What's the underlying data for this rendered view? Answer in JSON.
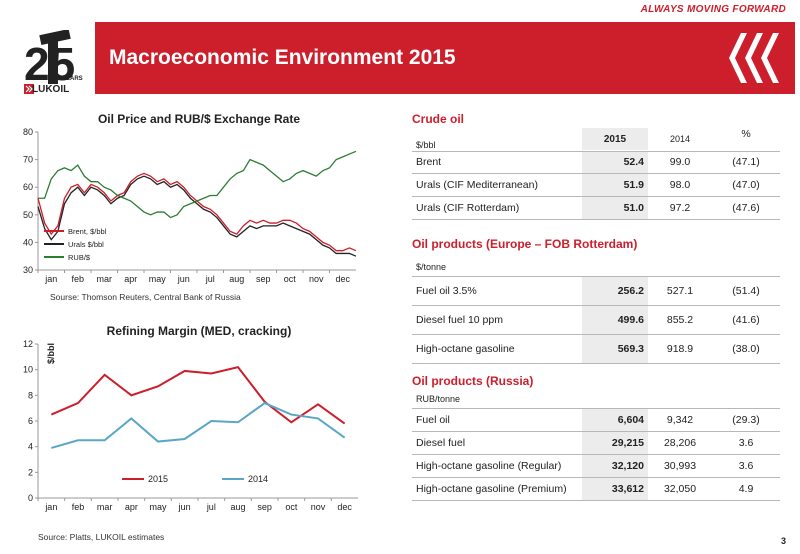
{
  "header": {
    "tagline": "ALWAYS MOVING FORWARD",
    "title": "Macroeconomic Environment 2015",
    "logo_text": "LUKOIL",
    "logo_number": "25",
    "logo_years": "YEARS"
  },
  "chart1": {
    "title": "Oil Price and RUB/$ Exchange Rate",
    "source": "Sourse: Thomson Reuters, Central Bank of Russia"
  },
  "chart2": {
    "title": "Refining Margin (MED, cracking)",
    "source": "Source: Platts, LUKOIL estimates"
  },
  "chart_data": [
    {
      "type": "line",
      "title": "Oil Price and RUB/$ Exchange Rate",
      "categories": [
        "jan",
        "feb",
        "mar",
        "apr",
        "may",
        "jun",
        "jul",
        "aug",
        "sep",
        "oct",
        "nov",
        "dec"
      ],
      "ylim": [
        30,
        80
      ],
      "yticks": [
        30,
        40,
        50,
        60,
        70,
        80
      ],
      "legend_position": "left-bottom",
      "series": [
        {
          "name": "Brent, $/bbl",
          "color": "#cc1e2b",
          "values": [
            56,
            47,
            43,
            46,
            56,
            60,
            61,
            58,
            61,
            60,
            58,
            55,
            57,
            58,
            62,
            64,
            65,
            64,
            62,
            63,
            61,
            62,
            60,
            57,
            55,
            53,
            52,
            50,
            47,
            44,
            43,
            46,
            48,
            47,
            48,
            47,
            47,
            48,
            48,
            47,
            45,
            44,
            42,
            40,
            39,
            37,
            37,
            38,
            37
          ]
        },
        {
          "name": "Urals $/bbl",
          "color": "#222222",
          "values": [
            53,
            45,
            41,
            44,
            54,
            58,
            60,
            57,
            60,
            59,
            57,
            54,
            56,
            57,
            61,
            63,
            64,
            63,
            61,
            62,
            60,
            61,
            59,
            56,
            54,
            52,
            51,
            49,
            46,
            43,
            42,
            44,
            46,
            45,
            46,
            46,
            46,
            47,
            46,
            45,
            44,
            43,
            41,
            39,
            38,
            36,
            36,
            36,
            35
          ]
        },
        {
          "name": "RUB/$",
          "color": "#2e7d32",
          "values": [
            56,
            56,
            63,
            66,
            67,
            66,
            68,
            64,
            62,
            62,
            60,
            59,
            57,
            56,
            55,
            53,
            51,
            50,
            51,
            51,
            49,
            50,
            53,
            54,
            55,
            56,
            57,
            57,
            60,
            63,
            65,
            66,
            70,
            69,
            68,
            66,
            64,
            62,
            63,
            65,
            66,
            65,
            64,
            66,
            67,
            70,
            71,
            72,
            73
          ]
        }
      ]
    },
    {
      "type": "line",
      "title": "Refining Margin (MED, cracking)",
      "ylabel": "$/bbl",
      "categories": [
        "jan",
        "feb",
        "mar",
        "apr",
        "may",
        "jun",
        "jul",
        "aug",
        "sep",
        "oct",
        "nov",
        "dec"
      ],
      "ylim": [
        0,
        12
      ],
      "yticks": [
        0,
        2,
        4,
        6,
        8,
        10,
        12
      ],
      "legend_position": "bottom",
      "series": [
        {
          "name": "2015",
          "color": "#cc1e2b",
          "values": [
            6.5,
            7.4,
            9.6,
            8.0,
            8.7,
            9.9,
            9.7,
            10.2,
            7.5,
            5.9,
            7.3,
            5.8
          ]
        },
        {
          "name": "2014",
          "color": "#5aa6c7",
          "values": [
            3.9,
            4.5,
            4.5,
            6.2,
            4.4,
            4.6,
            6.0,
            5.9,
            7.4,
            6.5,
            6.2,
            4.7
          ]
        }
      ]
    }
  ],
  "crude": {
    "heading": "Crude oil",
    "unit": "$/bbl",
    "col_2015": "2015",
    "col_2014": "2014",
    "col_pct": "%",
    "rows": [
      {
        "name": "Brent",
        "v2015": "52.4",
        "v2014": "99.0",
        "pct": "(47.1)"
      },
      {
        "name": "Urals (CIF Mediterranean)",
        "v2015": "51.9",
        "v2014": "98.0",
        "pct": "(47.0)"
      },
      {
        "name": "Urals (CIF Rotterdam)",
        "v2015": "51.0",
        "v2014": "97.2",
        "pct": "(47.6)"
      }
    ]
  },
  "products_eu": {
    "heading": "Oil products (Europe – FOB Rotterdam)",
    "unit": "$/tonne",
    "rows": [
      {
        "name": "Fuel oil 3.5%",
        "v2015": "256.2",
        "v2014": "527.1",
        "pct": "(51.4)"
      },
      {
        "name": "Diesel fuel 10 ppm",
        "v2015": "499.6",
        "v2014": "855.2",
        "pct": "(41.6)"
      },
      {
        "name": "High-octane gasoline",
        "v2015": "569.3",
        "v2014": "918.9",
        "pct": "(38.0)"
      }
    ]
  },
  "products_ru": {
    "heading": "Oil products (Russia)",
    "unit": "RUB/tonne",
    "rows": [
      {
        "name": "Fuel oil",
        "v2015": "6,604",
        "v2014": "9,342",
        "pct": "(29.3)"
      },
      {
        "name": "Diesel fuel",
        "v2015": "29,215",
        "v2014": "28,206",
        "pct": "3.6"
      },
      {
        "name": "High-octane gasoline (Regular)",
        "v2015": "32,120",
        "v2014": "30,993",
        "pct": "3.6"
      },
      {
        "name": "High-octane gasoline (Premium)",
        "v2015": "33,612",
        "v2014": "32,050",
        "pct": "4.9"
      }
    ]
  },
  "footer": {
    "page": "3"
  }
}
